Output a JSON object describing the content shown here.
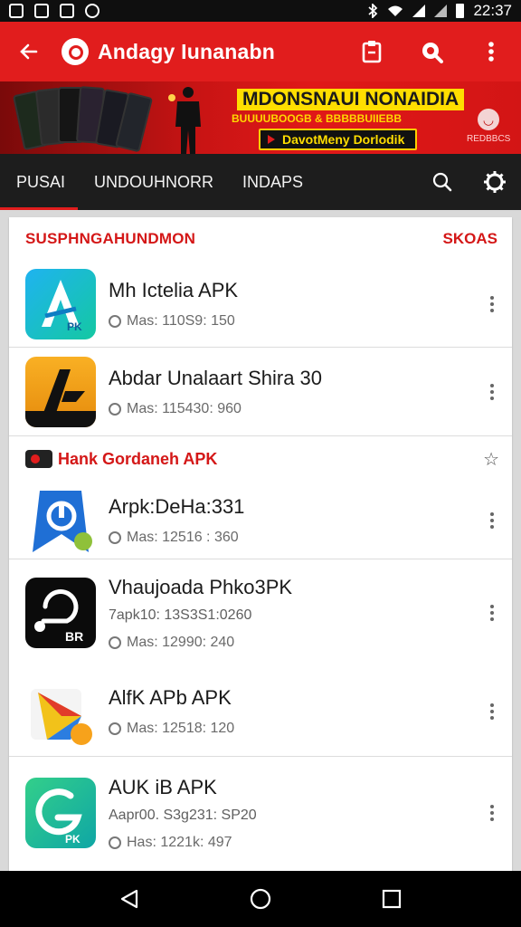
{
  "status_bar": {
    "time": "22:37",
    "icons": [
      "image-icon",
      "camera-icon",
      "gallery-icon",
      "location-icon",
      "bluetooth-icon",
      "wifi-icon",
      "signal-icon",
      "battery-icon"
    ]
  },
  "app_bar": {
    "title": "Andagy Iunanabn",
    "icons": [
      "back-arrow-icon",
      "app-logo-icon",
      "clipboard-icon",
      "search-icon",
      "more-vert-icon"
    ]
  },
  "banner": {
    "title": "MDONSNAUI NONAIDIA",
    "subtitle": "BUUUUBOOGB & BBBBBUIIEBB",
    "cta": "DavotMeny Dorlodik",
    "badge": "REDBBCS"
  },
  "tabs": [
    {
      "label": "PUSAI",
      "active": true
    },
    {
      "label": "UNDOUHNORR",
      "active": false
    },
    {
      "label": "INDAPS",
      "active": false
    }
  ],
  "tab_icons": [
    "search-icon",
    "settings-icon"
  ],
  "section1": {
    "title": "SUSPHNGAHUNDMON",
    "action": "SKOAS",
    "items": [
      {
        "name": "Mh Ictelia APK",
        "meta": "Mas: 110S9: 150",
        "icon": "aq-app-icon",
        "colors": [
          "#1aa7e8",
          "#19c0a8"
        ]
      },
      {
        "name": "Abdar Unalaart Shira 30",
        "meta": "Mas: 115430: 960",
        "icon": "ar-app-icon",
        "colors": [
          "#f7a21b",
          "#e98c10"
        ]
      }
    ]
  },
  "section2": {
    "title": "Hank Gordaneh APK",
    "items": [
      {
        "name": "Arpk:DeHa:331",
        "meta": "Mas: 12516 : 360",
        "icon": "blue-app-icon",
        "colors": [
          "#1a6fd6",
          "#3f98f0"
        ]
      },
      {
        "name": "Vhaujoada Phko3PK",
        "sub": "7apk10: 13S3S1:0260",
        "meta": "Mas: 12990: 240",
        "icon": "black-app-icon",
        "colors": [
          "#0a0a0a",
          "#0a0a0a"
        ]
      },
      {
        "name": "AlfK APb APK",
        "meta": "Mas: 12518: 120",
        "icon": "colorful-app-icon",
        "colors": [
          "#f2c41a",
          "#e13b2a"
        ]
      },
      {
        "name": "AUK iB APK",
        "sub": "Aapr00. S3g231: SP20",
        "meta": "Has: 1221k: 497",
        "icon": "green-app-icon",
        "colors": [
          "#2dc48a",
          "#12a8a0"
        ]
      }
    ]
  },
  "nav": {
    "icons": [
      "nav-back-icon",
      "nav-home-icon",
      "nav-recents-icon"
    ]
  }
}
